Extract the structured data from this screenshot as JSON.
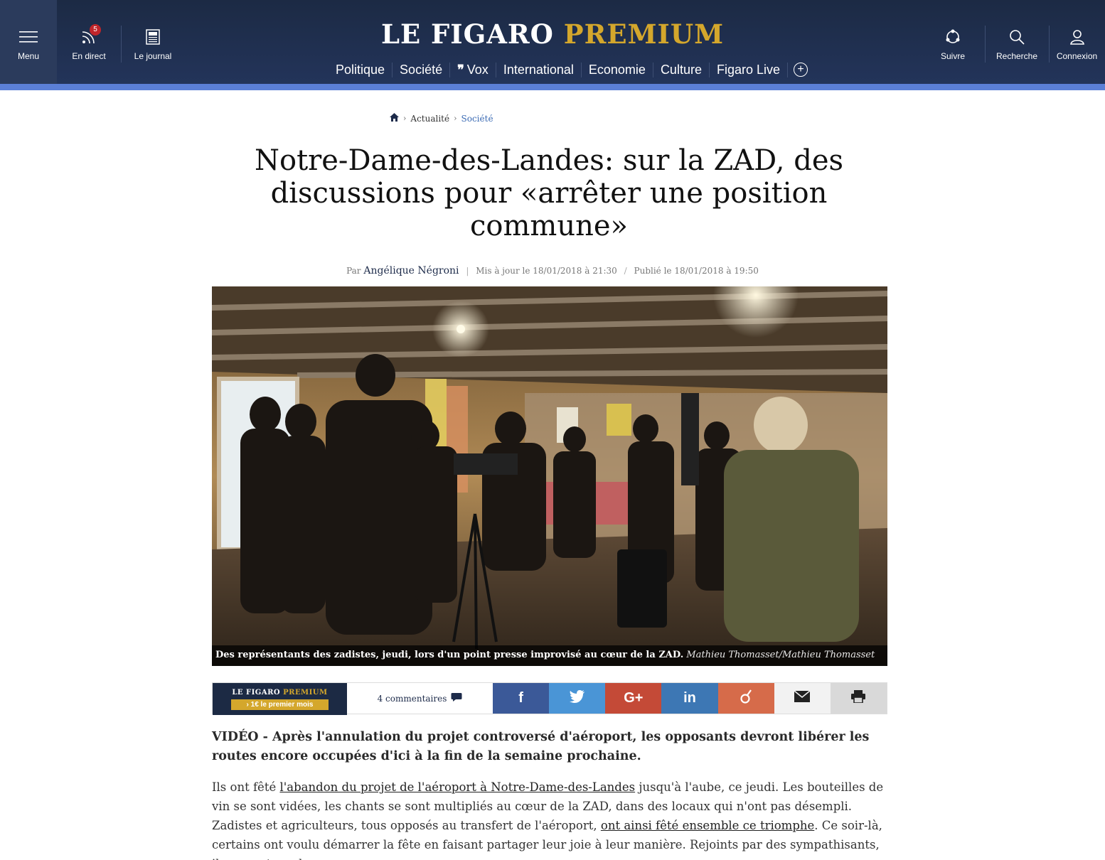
{
  "header": {
    "logo_part1": "LE FIGARO",
    "logo_part2": "PREMIUM",
    "menu_label": "Menu",
    "direct_label": "En direct",
    "direct_badge": "5",
    "journal_label": "Le journal",
    "suivre_label": "Suivre",
    "recherche_label": "Recherche",
    "connexion_label": "Connexion",
    "nav": [
      "Politique",
      "Société",
      "Vox",
      "International",
      "Economie",
      "Culture",
      "Figaro Live"
    ],
    "vox_quote": "❞"
  },
  "breadcrumb": {
    "home_icon": "home-icon",
    "items": [
      "Actualité",
      "Société"
    ]
  },
  "article": {
    "title": "Notre-Dame-des-Landes: sur la ZAD, des discussions pour «arrêter une position commune»",
    "by_prefix": "Par",
    "author": "Angélique Négroni",
    "updated": "Mis à jour le 18/01/2018 à 21:30",
    "published": "Publié le 18/01/2018 à 19:50",
    "caption_text": "Des représentants des zadistes, jeudi, lors d'un point presse improvisé au cœur de la ZAD.",
    "caption_credit": "Mathieu Thomasset/Mathieu Thomasset",
    "lede": "VIDÉO - Après l'annulation du projet controversé d'aéroport, les opposants devront libérer les routes encore occupées d'ici à la fin de la semaine prochaine.",
    "para_1": "Ils ont fêté ",
    "para_link1": "l'abandon du projet de l'aéroport à Notre-Dame-des-Landes",
    "para_2": " jusqu'à l'aube, ce jeudi. Les bouteilles de vin se sont vidées, les chants se sont multipliés au cœur de la ZAD, dans des locaux qui n'ont pas désempli. Zadistes et agriculteurs, tous opposés au transfert de l'aéroport, ",
    "para_link2": "ont ainsi fêté ensemble ce triomphe",
    "para_3": ". Ce soir-là, certains ont voulu démarrer la fête en faisant partager leur joie à leur manière. Rejoints par des sympathisants, ils se sont rendus"
  },
  "sharebar": {
    "premium_part1": "LE FIGARO",
    "premium_part2": "PREMIUM",
    "premium_offer": "›  1€ le premier mois",
    "comments": "4 commentaires",
    "facebook": "f",
    "googleplus": "G+",
    "linkedin": "in"
  },
  "colors": {
    "header_bg": "#1c2a44",
    "premium_gold": "#d4a72c",
    "band_blue": "#5b7fd6"
  }
}
